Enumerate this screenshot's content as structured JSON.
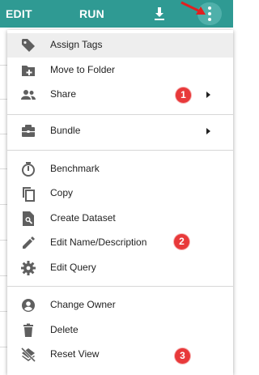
{
  "toolbar": {
    "edit_label": "EDIT",
    "run_label": "RUN",
    "download_icon": "download-icon",
    "more_icon": "more-vertical-icon",
    "color": "#2f9a93"
  },
  "menu": {
    "items": [
      {
        "label": "Assign Tags",
        "icon": "tag-icon"
      },
      {
        "label": "Move to Folder",
        "icon": "folder-plus-icon"
      },
      {
        "label": "Share",
        "icon": "people-icon",
        "submenu": true
      },
      {
        "label": "Bundle",
        "icon": "briefcase-icon",
        "submenu": true
      },
      {
        "label": "Benchmark",
        "icon": "timer-icon"
      },
      {
        "label": "Copy",
        "icon": "copy-icon"
      },
      {
        "label": "Create Dataset",
        "icon": "file-search-icon"
      },
      {
        "label": "Edit Name/Description",
        "icon": "pencil-icon"
      },
      {
        "label": "Edit Query",
        "icon": "gear-icon"
      },
      {
        "label": "Change Owner",
        "icon": "account-circle-icon"
      },
      {
        "label": "Delete",
        "icon": "trash-icon"
      },
      {
        "label": "Reset View",
        "icon": "layers-off-icon"
      }
    ]
  },
  "badges": [
    "1",
    "2",
    "3"
  ],
  "annotation_color": "#e8393a"
}
